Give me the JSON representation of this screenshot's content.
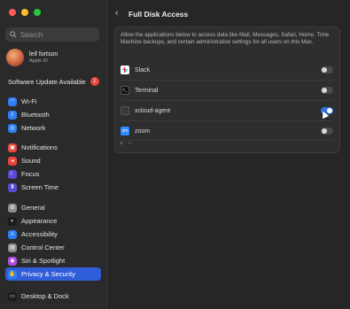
{
  "sidebar": {
    "search_placeholder": "Search",
    "profile": {
      "name": "leif fortson",
      "subtitle": "Apple ID"
    },
    "update": {
      "label": "Software Update Available",
      "count": "1"
    },
    "group1": [
      {
        "label": "Wi-Fi",
        "icon": "wifi-icon",
        "color": "#2f7ef6"
      },
      {
        "label": "Bluetooth",
        "icon": "bluetooth-icon",
        "color": "#2f7ef6"
      },
      {
        "label": "Network",
        "icon": "network-icon",
        "color": "#2f7ef6"
      }
    ],
    "group2": [
      {
        "label": "Notifications",
        "icon": "notifications-icon",
        "color": "#e8463a"
      },
      {
        "label": "Sound",
        "icon": "sound-icon",
        "color": "#e8463a"
      },
      {
        "label": "Focus",
        "icon": "focus-icon",
        "color": "#5b4bd6"
      },
      {
        "label": "Screen Time",
        "icon": "screen-time-icon",
        "color": "#5b4bd6"
      }
    ],
    "group3": [
      {
        "label": "General",
        "icon": "general-icon",
        "color": "#8e8e93"
      },
      {
        "label": "Appearance",
        "icon": "appearance-icon",
        "color": "#1c1c1e"
      },
      {
        "label": "Accessibility",
        "icon": "accessibility-icon",
        "color": "#2f7ef6"
      },
      {
        "label": "Control Center",
        "icon": "control-center-icon",
        "color": "#8e8e93"
      },
      {
        "label": "Siri & Spotlight",
        "icon": "siri-icon",
        "color": "#b04be0"
      },
      {
        "label": "Privacy & Security",
        "icon": "privacy-icon",
        "color": "#2f7ef6",
        "selected": true
      }
    ],
    "group4": [
      {
        "label": "Desktop & Dock",
        "icon": "desktop-dock-icon",
        "color": "#1c1c1e"
      }
    ]
  },
  "main": {
    "title": "Full Disk Access",
    "description": "Allow the applications below to access data like Mail, Messages, Safari, Home, Time Machine backups, and certain administrative settings for all users on this Mac.",
    "apps": [
      {
        "name": "Slack",
        "icon": "slack-icon",
        "enabled": false
      },
      {
        "name": "Terminal",
        "icon": "terminal-icon",
        "enabled": false
      },
      {
        "name": "xcloud-agent",
        "icon": "xcloud-agent-icon",
        "enabled": true
      },
      {
        "name": "zoom",
        "icon": "zoom-icon",
        "enabled": false
      }
    ],
    "add_label": "+",
    "remove_label": "−"
  },
  "colors": {
    "accent": "#2f5ed8",
    "toggle_on": "#2f72ef"
  }
}
